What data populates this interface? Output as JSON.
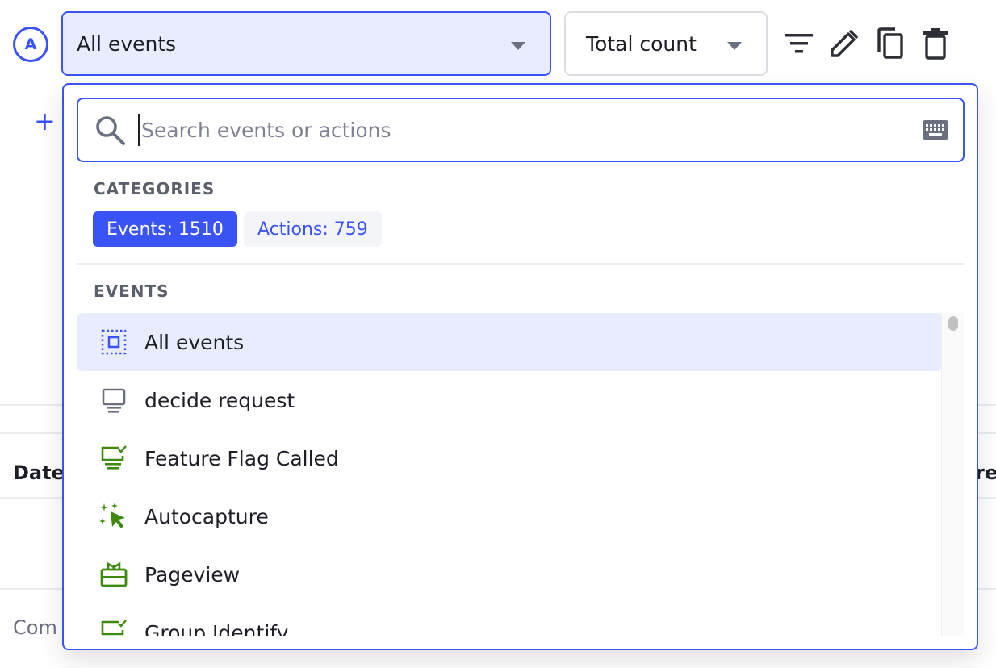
{
  "series": {
    "badge_letter": "A",
    "event_select_value": "All events",
    "math_select_value": "Total count"
  },
  "toolbar": {
    "icons": [
      "filter-icon",
      "edit-pencil-icon",
      "copy-icon",
      "delete-trash-icon"
    ]
  },
  "background": {
    "add_label": "+",
    "table_header_left": "Date",
    "table_header_right": "re",
    "row_left": "Com"
  },
  "dropdown": {
    "search": {
      "placeholder": "Search events or actions",
      "value": ""
    },
    "categories_title": "CATEGORIES",
    "categories": [
      {
        "label": "Events: 1510",
        "active": true
      },
      {
        "label": "Actions: 759",
        "active": false
      }
    ],
    "events_title": "EVENTS",
    "events": [
      {
        "label": "All events",
        "icon": "all-events-icon",
        "selected": true
      },
      {
        "label": "decide request",
        "icon": "monitor-icon",
        "selected": false
      },
      {
        "label": "Feature Flag Called",
        "icon": "feature-flag-icon",
        "selected": false
      },
      {
        "label": "Autocapture",
        "icon": "autocapture-cursor-icon",
        "selected": false
      },
      {
        "label": "Pageview",
        "icon": "pageview-icon",
        "selected": false
      },
      {
        "label": "Group Identify",
        "icon": "group-identify-icon",
        "selected": false
      }
    ]
  },
  "colors": {
    "primary": "#3a53f5",
    "selected_bg": "#e8ecfd",
    "green_icon": "#3f8b0f",
    "muted_icon": "#6b7080"
  }
}
